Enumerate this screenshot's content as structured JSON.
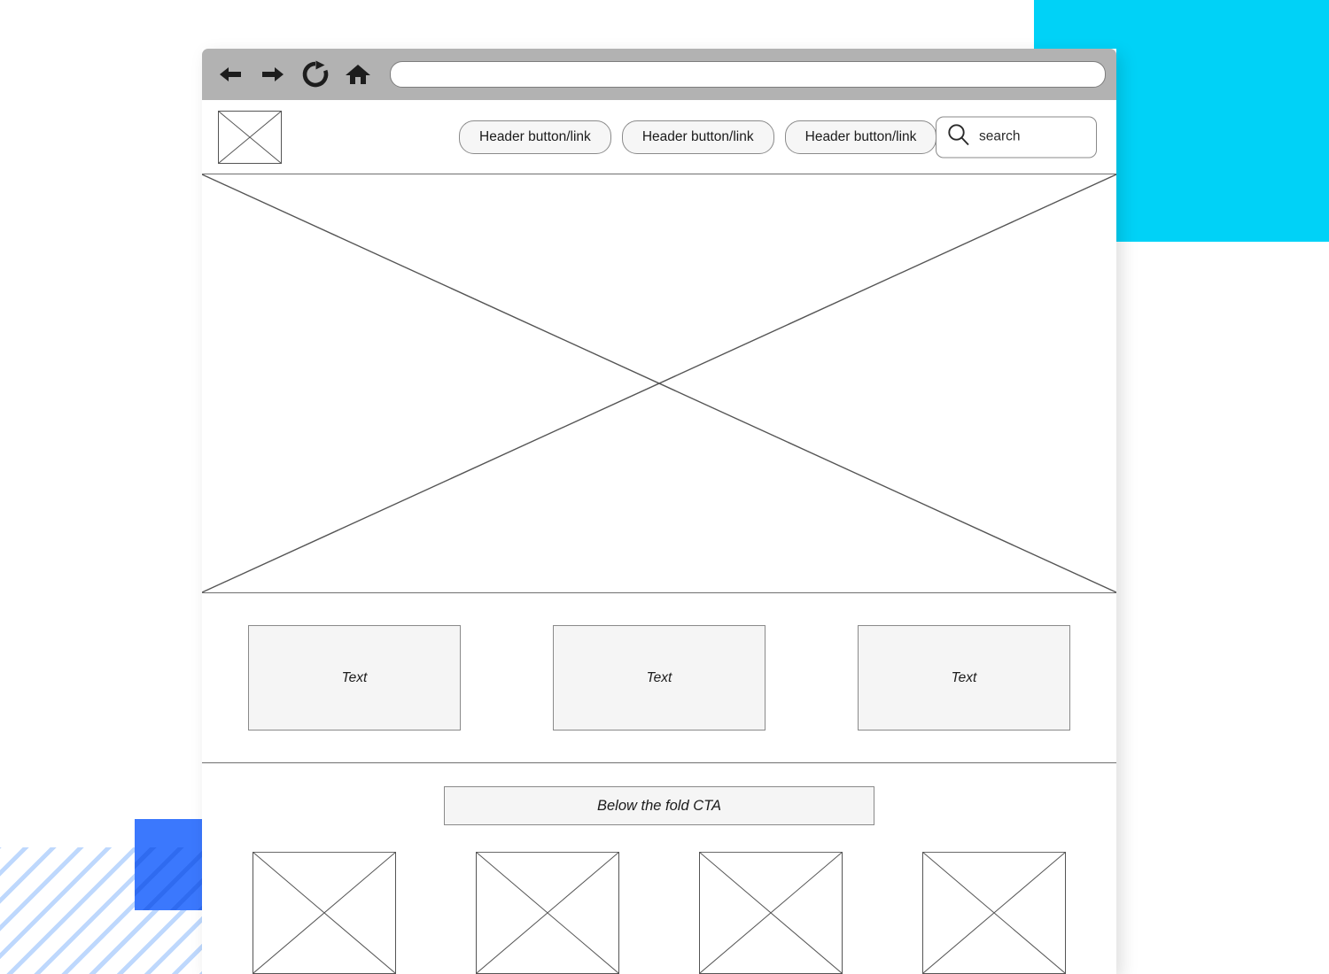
{
  "decor": {
    "cyan_block_color": "#00d2f7",
    "blue_block_color": "#3b78fd",
    "stripe_color": "#bed8fd"
  },
  "browser": {
    "toolbar": {
      "back_icon": "back-arrow-icon",
      "forward_icon": "forward-arrow-icon",
      "reload_icon": "reload-icon",
      "home_icon": "home-icon",
      "url_value": "",
      "url_placeholder": ""
    }
  },
  "site_header": {
    "logo_alt": "logo-placeholder",
    "nav_buttons": [
      {
        "label": "Header button/link"
      },
      {
        "label": "Header button/link"
      },
      {
        "label": "Header button/link"
      }
    ],
    "search": {
      "icon": "search-icon",
      "value": "",
      "placeholder": "search",
      "display_text": "search"
    }
  },
  "hero": {
    "alt": "hero-image-placeholder"
  },
  "cards": [
    {
      "label": "Text"
    },
    {
      "label": "Text"
    },
    {
      "label": "Text"
    }
  ],
  "fold": {
    "cta_label": "Below the fold CTA",
    "thumbnails": [
      {
        "alt": "thumbnail-image-placeholder"
      },
      {
        "alt": "thumbnail-image-placeholder"
      },
      {
        "alt": "thumbnail-image-placeholder"
      },
      {
        "alt": "thumbnail-image-placeholder"
      }
    ]
  }
}
